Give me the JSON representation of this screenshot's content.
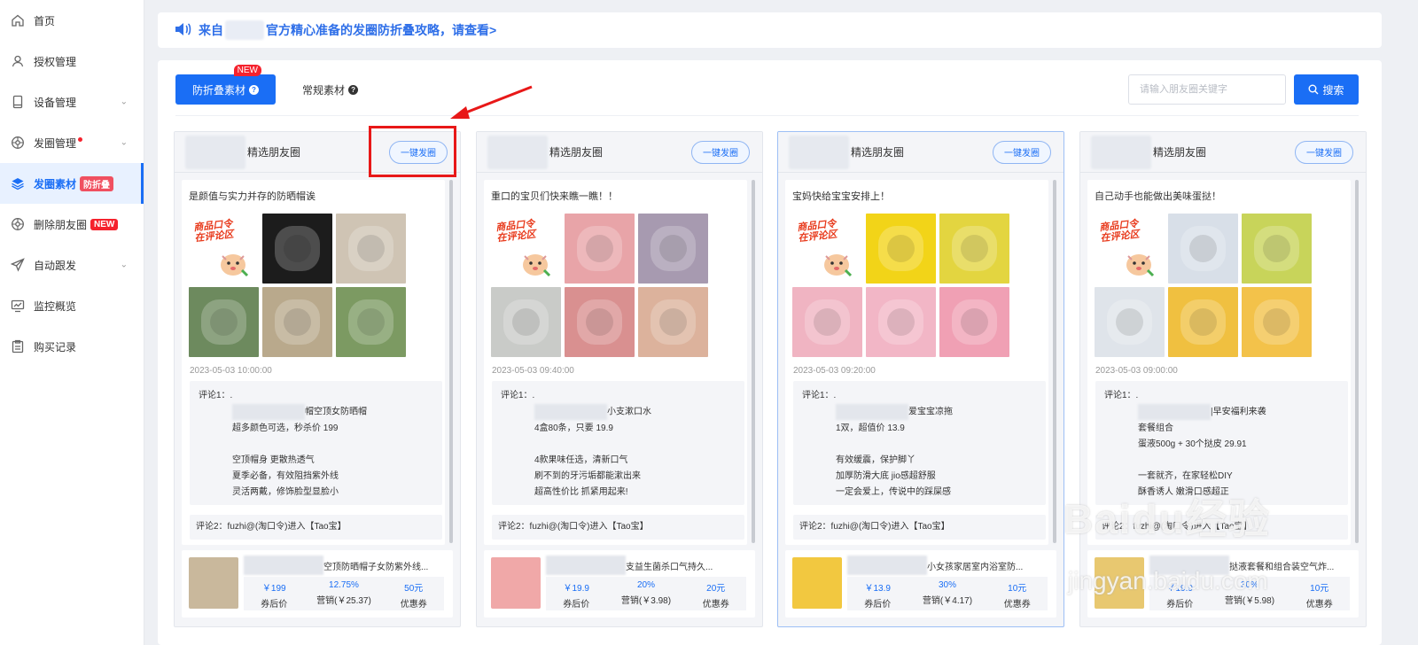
{
  "sidebar": {
    "items": [
      {
        "label": "首页",
        "icon": "home-icon"
      },
      {
        "label": "授权管理",
        "icon": "user-icon"
      },
      {
        "label": "设备管理",
        "icon": "device-icon",
        "chevron": true
      },
      {
        "label": "发圈管理",
        "icon": "aperture-icon",
        "chevron": true,
        "dot": true
      },
      {
        "label": "发圈素材",
        "icon": "layers-icon",
        "badge": "防折叠",
        "active": true
      },
      {
        "label": "删除朋友圈",
        "icon": "aperture-icon",
        "badge": "NEW"
      },
      {
        "label": "自动跟发",
        "icon": "send-icon",
        "chevron": true
      },
      {
        "label": "监控概览",
        "icon": "monitor-icon"
      },
      {
        "label": "购买记录",
        "icon": "clipboard-icon"
      }
    ]
  },
  "notice": {
    "prefix": "来自",
    "suffix": "官方精心准备的发圈防折叠攻略，请查看>"
  },
  "tabs": {
    "primary": "防折叠素材",
    "primary_badge": "NEW",
    "secondary": "常规素材"
  },
  "search": {
    "placeholder": "请输入朋友圈关键字",
    "button": "搜索"
  },
  "card_title_suffix": "精选朋友圈",
  "post_button": "一键发圈",
  "comment_label1": "评论1：.",
  "comment2": "评论2：fuzhi@(淘口令)进入【Tao宝】",
  "stat_labels": {
    "coupon_price": "券后价",
    "sales": "营销",
    "coupon": "优惠券"
  },
  "cards": [
    {
      "text": "是颜值与实力并存的防晒帽诶",
      "time": "2023-05-03 10:00:00",
      "comment_lines": [
        "帽空顶女防晒帽",
        "超多颜色可选，秒杀价  199",
        "",
        "空顶帽身  更散热透气",
        "夏季必备，有效阻挡紫外线",
        "灵活两戴，修饰脸型显脸小"
      ],
      "product_title": "空顶防晒帽子女防紫外线...",
      "price": "￥199",
      "rate": "12.75%",
      "sales": "营销(￥25.37)",
      "coupon": "50元"
    },
    {
      "text": "重口的宝贝们快来瞧一瞧！！",
      "time": "2023-05-03 09:40:00",
      "comment_lines": [
        "小支漱口水",
        "4盒80条，只要  19.9",
        "",
        "4款果味任选，清新口气",
        "刷不到的牙污垢都能漱出来",
        "超高性价比  抓紧用起来!"
      ],
      "product_title": "支益生菌杀口气持久...",
      "price": "￥19.9",
      "rate": "20%",
      "sales": "营销(￥3.98)",
      "coupon": "20元"
    },
    {
      "text": "宝妈快给宝宝安排上！",
      "time": "2023-05-03 09:20:00",
      "comment_lines": [
        "爱宝宝凉拖",
        "1双，超值价  13.9",
        "",
        "有效缓震，保护脚丫",
        "加厚防滑大底  jio感超舒服",
        "一定会爱上，传说中的踩屎感"
      ],
      "product_title": "小女孩家居室内浴室防...",
      "price": "￥13.9",
      "rate": "30%",
      "sales": "营销(￥4.17)",
      "coupon": "10元"
    },
    {
      "text": "自己动手也能做出美味蛋挞！",
      "time": "2023-05-03 09:00:00",
      "comment_lines": [
        "|早安福利来袭",
        "套餐组合",
        "蛋液500g + 30个挞皮  29.91",
        "",
        "一套就齐，在家轻松DIY",
        "酥香诱人  嫩滑口感超正"
      ],
      "product_title": "挞液套餐和组合装空气炸...",
      "price": "￥19.9",
      "rate": "30%",
      "sales": "营销(￥5.98)",
      "coupon": "10元"
    }
  ],
  "watermark": {
    "main": "Baidu经验",
    "sub": "jingyan.baidu.com"
  },
  "colors": {
    "accent": "#1a6ef5",
    "annotation": "#e81818",
    "badge_red": "#f5222d"
  }
}
